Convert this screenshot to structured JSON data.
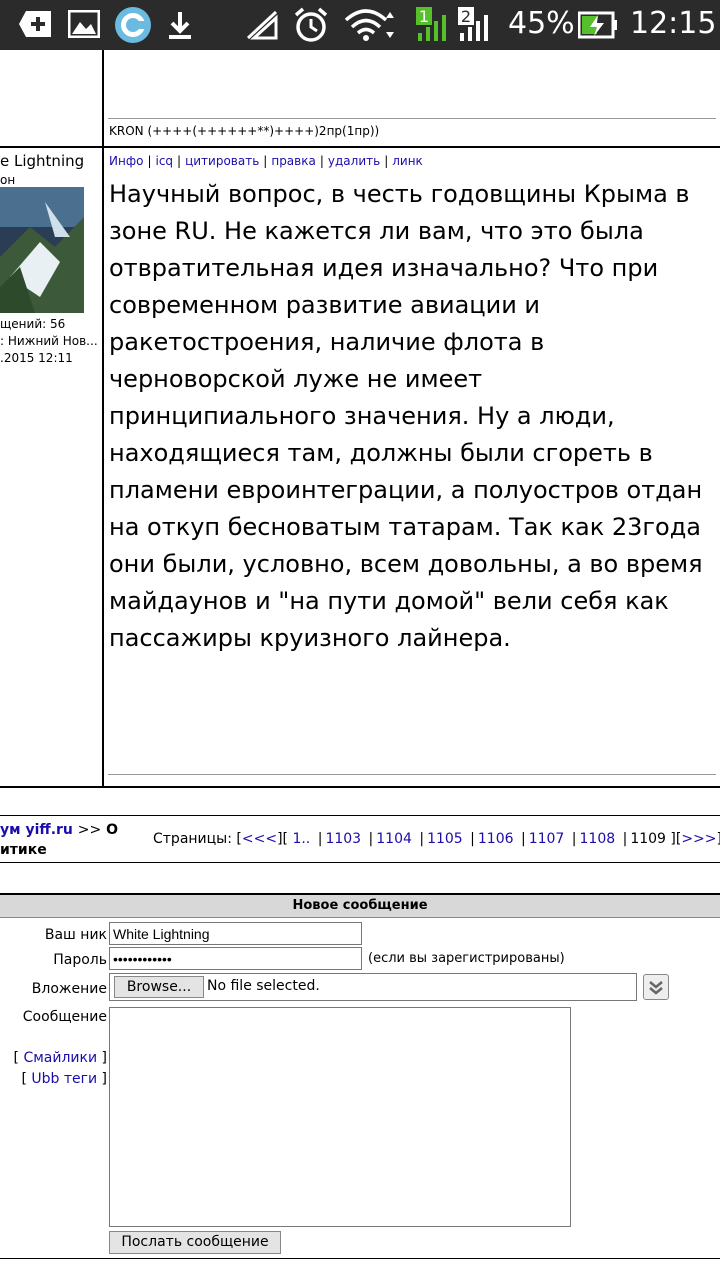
{
  "status_bar": {
    "battery_percent": "45%",
    "time": "12:15",
    "sim1": "1",
    "sim2": "2"
  },
  "post": {
    "signature": "KRON (++++(++++++**)++++)2пр(1пр))",
    "author": {
      "name": "e Lightning",
      "subtitle": "он",
      "messages": "щений: 56",
      "location": ": Нижний Нов...",
      "date": ".2015 12:11"
    },
    "links": [
      "Инфо",
      "icq",
      "цитировать",
      "правка",
      "удалить",
      "линк"
    ],
    "message": "Научный вопрос, в честь годовщины Крыма в зоне RU. Не кажется ли вам, что это была отвратительная идея изначально? Что при современном развитие авиации и ракетостроения, наличие флота в черноворской луже не имеет принципиального значения. Ну а люди, находящиеся там, должны были сгореть в пламени евроинтеграции, а полуостров отдан на откуп бесноватым татарам. Так как 23года они были, условно, всем довольны, а во время майдаунов и \"на пути домой\" вели себя как пассажиры круизного лайнера."
  },
  "breadcrumb": {
    "link": "ум yiff.ru",
    "sep": ">>",
    "rest1": "О",
    "rest2": "итике"
  },
  "pagination": {
    "label": "Страницы:",
    "prev": "<<<",
    "first": "1..",
    "pages": [
      "1103",
      "1104",
      "1105",
      "1106",
      "1107",
      "1108"
    ],
    "current": "1109",
    "next": ">>>"
  },
  "form": {
    "title": "Новое сообщение",
    "nick_label": "Ваш ник",
    "nick_value": "White Lightning",
    "password_label": "Пароль",
    "password_value": "••••••••••••",
    "password_hint": "(если вы зарегистрированы)",
    "attachment_label": "Вложение",
    "browse_label": "Browse...",
    "file_status": "No file selected.",
    "message_label": "Сообщение",
    "smilies_link": "Смайлики",
    "ubb_link": "Ubb теги",
    "submit_label": "Послать сообщение"
  }
}
